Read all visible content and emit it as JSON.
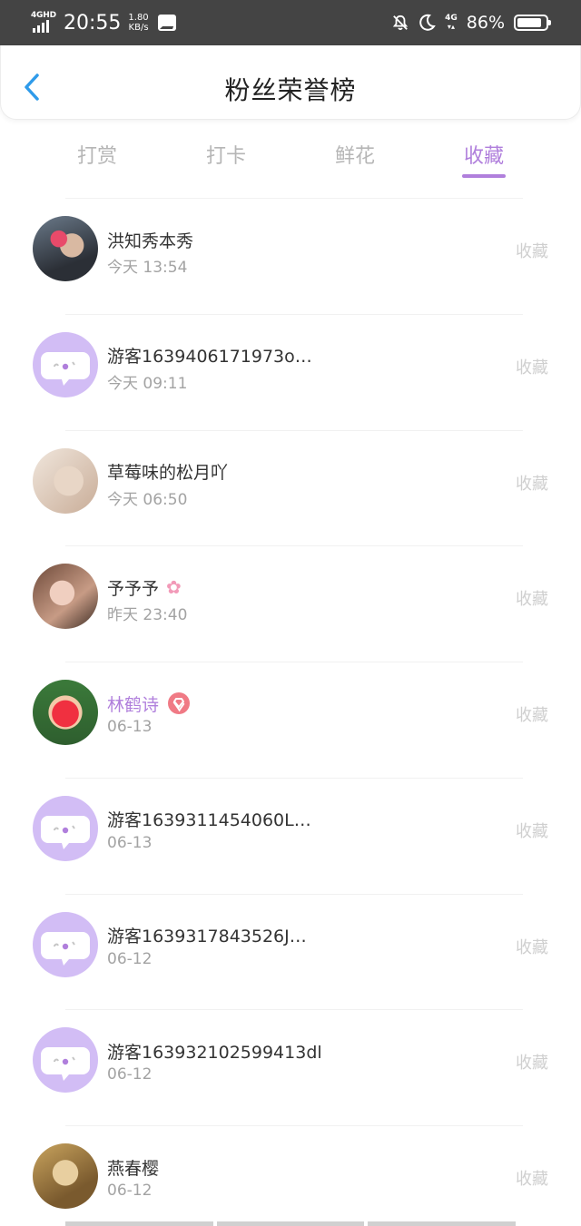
{
  "status_bar": {
    "network_type": "4GHD",
    "time": "20:55",
    "speed_value": "1.80",
    "speed_unit": "KB/s",
    "network_4g": "4G",
    "battery_percent": "86%",
    "battery_level": 0.86
  },
  "header": {
    "title": "粉丝荣誉榜"
  },
  "tabs": [
    {
      "label": "打赏",
      "active": false
    },
    {
      "label": "打卡",
      "active": false
    },
    {
      "label": "鲜花",
      "active": false
    },
    {
      "label": "收藏",
      "active": true
    }
  ],
  "fans": [
    {
      "name": "洪知秀本秀",
      "time": "今天 13:54",
      "action": "收藏",
      "avatar": "photo",
      "badge": ""
    },
    {
      "name": "游客1639406171973o…",
      "time": "今天 09:11",
      "action": "收藏",
      "avatar": "default-chat-avatar",
      "badge": ""
    },
    {
      "name": "草莓味的松月吖",
      "time": "今天 06:50",
      "action": "收藏",
      "avatar": "photo",
      "badge": ""
    },
    {
      "name": "予予予",
      "time": "昨天 23:40",
      "action": "收藏",
      "avatar": "photo",
      "badge": "flower-emoji"
    },
    {
      "name": "林鹤诗",
      "time": "06-13",
      "action": "收藏",
      "avatar": "photo",
      "badge": "vip-gem"
    },
    {
      "name": "游客1639311454060L…",
      "time": "06-13",
      "action": "收藏",
      "avatar": "default-chat-avatar",
      "badge": ""
    },
    {
      "name": "游客1639317843526J…",
      "time": "06-12",
      "action": "收藏",
      "avatar": "default-chat-avatar",
      "badge": ""
    },
    {
      "name": "游客163932102599413dl",
      "time": "06-12",
      "action": "收藏",
      "avatar": "default-chat-avatar",
      "badge": ""
    },
    {
      "name": "燕春樱",
      "time": "06-12",
      "action": "收藏",
      "avatar": "photo",
      "badge": ""
    }
  ],
  "colors": {
    "accent": "#b07fdc",
    "status_bar": "#444444",
    "back_arrow": "#2f9bea",
    "placeholder_avatar": "#d2bdf5",
    "vip_badge": "#f07a85"
  }
}
